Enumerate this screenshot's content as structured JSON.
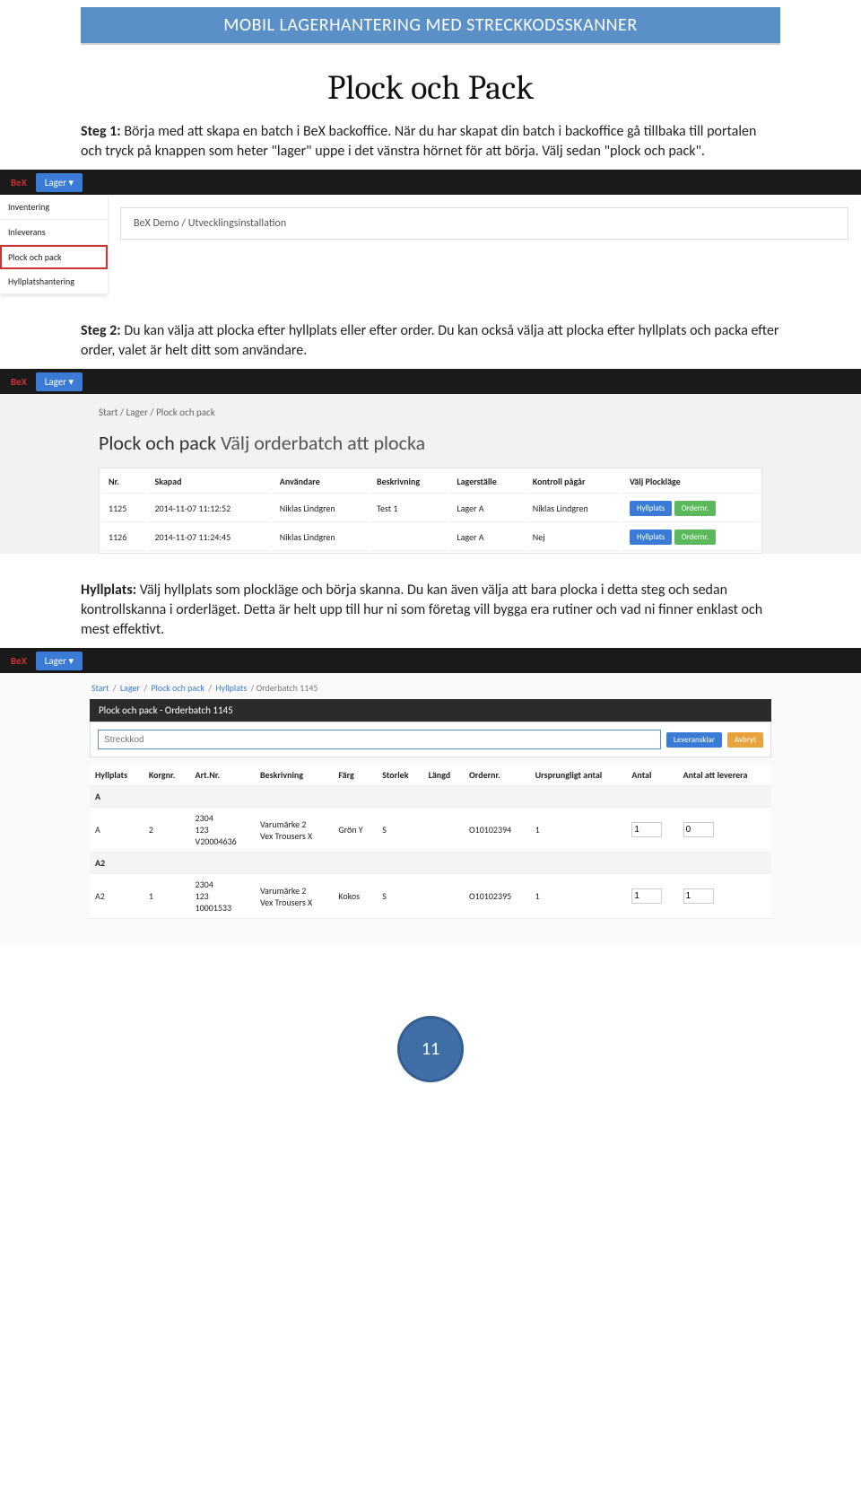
{
  "doc_header": "MOBIL LAGERHANTERING MED STRECKKODSSKANNER",
  "page_title": "Plock och Pack",
  "para1": {
    "bold": "Steg 1:",
    "text": " Börja med att skapa en batch i BeX backoffice. När du har skapat din batch i backoffice gå tillbaka till portalen och tryck på knappen som heter \"lager\" uppe i det vänstra hörnet för att börja. Välj sedan \"plock och pack\"."
  },
  "shot1": {
    "brand": "BeX",
    "lager": "Lager ▾",
    "menu": [
      "Inventering",
      "Inleverans",
      "Plock och pack",
      "Hyllplatshantering"
    ],
    "breadcrumb": "BeX Demo / Utvecklingsinstallation"
  },
  "para2": {
    "bold": "Steg 2:",
    "text": " Du kan välja att plocka efter hyllplats eller efter order. Du kan också välja att plocka efter hyllplats och packa efter order, valet är helt ditt som användare."
  },
  "shot2": {
    "brand": "BeX",
    "lager": "Lager ▾",
    "crumb": "Start  /  Lager  /  Plock och pack",
    "title_main": "Plock och pack",
    "title_sub": "Välj orderbatch att plocka",
    "headers": [
      "Nr.",
      "Skapad",
      "Användare",
      "Beskrivning",
      "Lagerställe",
      "Kontroll pågår",
      "Välj Plockläge"
    ],
    "rows": [
      {
        "nr": "1125",
        "skapad": "2014-11-07 11:12:52",
        "anv": "Niklas Lindgren",
        "beskr": "Test 1",
        "lager": "Lager A",
        "kontroll": "Niklas Lindgren",
        "btn1": "Hyllplats",
        "btn2": "Ordernr."
      },
      {
        "nr": "1126",
        "skapad": "2014-11-07 11:24:45",
        "anv": "Niklas Lindgren",
        "beskr": "",
        "lager": "Lager A",
        "kontroll": "Nej",
        "btn1": "Hyllplats",
        "btn2": "Ordernr."
      }
    ]
  },
  "para3": {
    "bold": "Hyllplats:",
    "text": " Välj hyllplats som plockläge och börja skanna. Du kan även välja att bara plocka i detta steg och sedan kontrollskanna i orderläget. Detta är helt upp till hur ni som företag vill bygga era rutiner och vad ni finner enklast och mest effektivt."
  },
  "shot3": {
    "brand": "BeX",
    "lager": "Lager ▾",
    "crumb": [
      "Start",
      "Lager",
      "Plock och pack",
      "Hyllplats",
      "Orderbatch 1145"
    ],
    "panel_title": "Plock och pack - Orderbatch 1145",
    "input_placeholder": "Streckkod",
    "btn_lev": "Leveransklar",
    "btn_avbryt": "Avbryt",
    "headers": [
      "Hyllplats",
      "Korgnr.",
      "Art.Nr.",
      "Beskrivning",
      "Färg",
      "Storlek",
      "Längd",
      "Ordernr.",
      "Ursprungligt antal",
      "Antal",
      "Antal att leverera"
    ],
    "groups": [
      {
        "label": "A",
        "rows": [
          {
            "hyll": "A",
            "korg": "2",
            "art": "2304\n123\nV20004636",
            "beskr": "Varumärke 2\nVex Trousers X",
            "farg": "Grön Y",
            "storlek": "S",
            "langd": "",
            "order": "O10102394",
            "urspr": "1",
            "antal": "1",
            "lev": "0"
          }
        ]
      },
      {
        "label": "A2",
        "rows": [
          {
            "hyll": "A2",
            "korg": "1",
            "art": "2304\n123\n10001533",
            "beskr": "Varumärke 2\nVex Trousers X",
            "farg": "Kokos",
            "storlek": "S",
            "langd": "",
            "order": "O10102395",
            "urspr": "1",
            "antal": "1",
            "lev": "1"
          }
        ]
      }
    ]
  },
  "page_number": "11"
}
